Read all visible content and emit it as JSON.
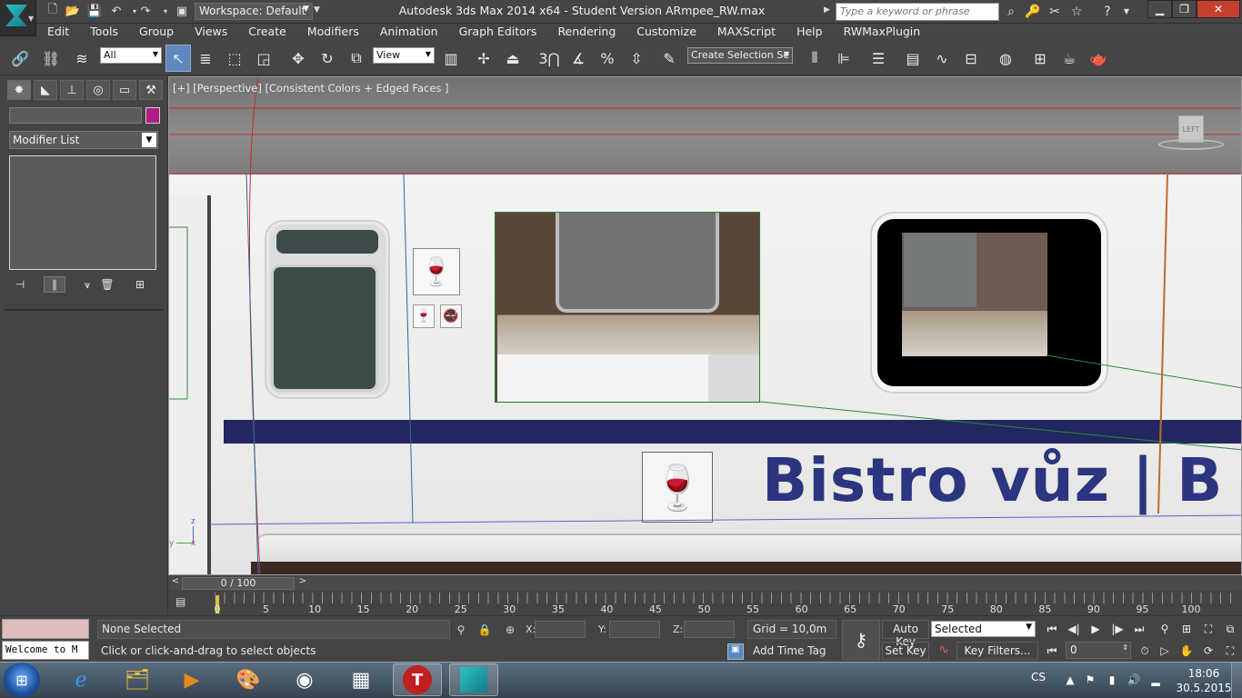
{
  "titlebar": {
    "workspace": "Workspace: Default",
    "title": "Autodesk 3ds Max  2014 x64  - Student Version    ARmpee_RW.max",
    "search_placeholder": "Type a keyword or phrase"
  },
  "menu": [
    "Edit",
    "Tools",
    "Group",
    "Views",
    "Create",
    "Modifiers",
    "Animation",
    "Graph Editors",
    "Rendering",
    "Customize",
    "MAXScript",
    "Help",
    "RWMaxPlugin"
  ],
  "toolbar": {
    "filter_value": "All",
    "ref_coord_value": "View",
    "named_sel_value": "Create Selection Se"
  },
  "command_panel": {
    "modifier_list": "Modifier List"
  },
  "viewport": {
    "label": "[+] [Perspective] [Consistent Colors + Edged Faces ]",
    "viewcube_face": "LEFT",
    "sign_text": "Bistro vůz | B",
    "axis_x": "x",
    "axis_y": "y",
    "axis_z": "z"
  },
  "timeline": {
    "slider_text": "0 / 100",
    "ticks": [
      "0",
      "5",
      "10",
      "15",
      "20",
      "25",
      "30",
      "35",
      "40",
      "45",
      "50",
      "55",
      "60",
      "65",
      "70",
      "75",
      "80",
      "85",
      "90",
      "95",
      "100"
    ]
  },
  "status": {
    "listener": "Welcome to M",
    "selection": "None Selected",
    "prompt": "Click or click-and-drag to select objects",
    "x_label": "X:",
    "y_label": "Y:",
    "z_label": "Z:",
    "grid": "Grid = 10,0m",
    "add_time_tag": "Add Time Tag",
    "auto_key": "Auto Key",
    "set_key": "Set Key",
    "key_mode": "Selected",
    "key_filters": "Key Filters...",
    "frame": "0"
  },
  "taskbar": {
    "lang": "CS",
    "time": "18:06",
    "date": "30.5.2015"
  },
  "colors": {
    "object_color": "#b01c86",
    "sign_blue": "#2b3580"
  }
}
